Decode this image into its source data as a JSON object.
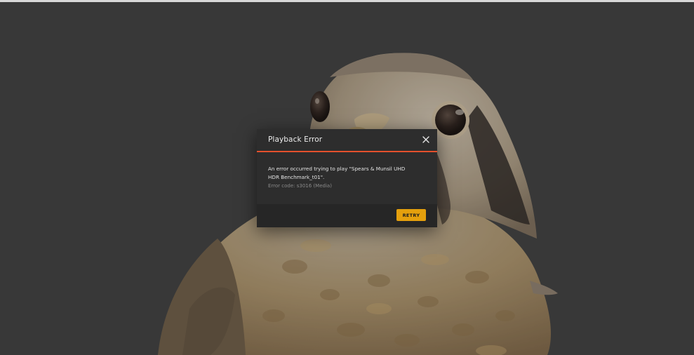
{
  "colors": {
    "background": "#3c3c3c",
    "dialog_bg": "#2d2d2d",
    "accent_line": "#e5502c",
    "retry_button": "#e5a00d"
  },
  "backdrop": {
    "icon": "kestrel-bird-photo"
  },
  "dialog": {
    "title": "Playback Error",
    "close_icon": "close-icon",
    "message": "An error occurred trying to play \"Spears & Munsil UHD HDR Benchmark_t01\".",
    "error_code": "Error code: s3016 (Media)",
    "retry_label": "RETRY"
  }
}
